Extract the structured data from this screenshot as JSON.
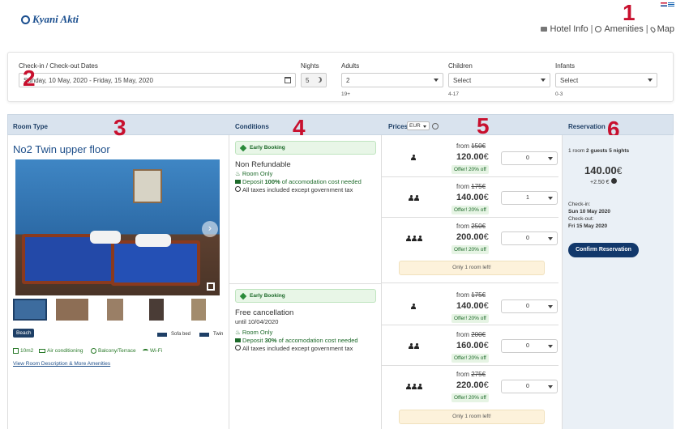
{
  "header": {
    "brand": "Kyani Akti",
    "nav": {
      "hotel_info": "Hotel Info",
      "amenities": "Amenities",
      "map": "Map",
      "sep": "|"
    }
  },
  "annotations": [
    "1",
    "2",
    "3",
    "4",
    "5",
    "6"
  ],
  "search": {
    "dates_label": "Check-in / Check-out Dates",
    "dates_value": "Sunday, 10 May, 2020 - Friday, 15 May, 2020",
    "nights_label": "Nights",
    "nights_value": "5",
    "adults_label": "Adults",
    "adults_value": "2",
    "adults_sub": "19+",
    "children_label": "Children",
    "children_value": "Select",
    "children_sub": "4-17",
    "infants_label": "Infants",
    "infants_value": "Select",
    "infants_sub": "0-3"
  },
  "table_headers": {
    "room_type": "Room Type",
    "conditions": "Conditions",
    "prices": "Prices",
    "currency": "EUR",
    "reservation": "Reservation"
  },
  "room": {
    "title": "No2 Twin upper floor",
    "tag": "Beach",
    "beds": [
      "Sofa bed",
      "Twin"
    ],
    "amenities": [
      "10m2",
      "Air conditioning",
      "Balcony/Terrace",
      "Wi-Fi"
    ],
    "link": "View Room Description & More Amenities"
  },
  "offers": [
    {
      "badge": "Early Booking",
      "name": "Non Refundable",
      "until": "",
      "meal": "Room Only",
      "deposit_pre": "Deposit ",
      "deposit_bold": "100%",
      "deposit_post": " of accomodation cost needed",
      "taxes": "All taxes included except government tax",
      "rows": [
        {
          "old_pre": "from ",
          "old": "150€",
          "price": "120.00",
          "cur": "€",
          "offer": "Offer! 20% off",
          "qty": "0",
          "persons": 1
        },
        {
          "old_pre": "from ",
          "old": "175€",
          "price": "140.00",
          "cur": "€",
          "offer": "Offer! 20% off",
          "qty": "1",
          "persons": 2
        },
        {
          "old_pre": "from ",
          "old": "250€",
          "price": "200.00",
          "cur": "€",
          "offer": "Offer! 20% off",
          "qty": "0",
          "persons": 3
        }
      ],
      "note": "Only 1 room left!"
    },
    {
      "badge": "Early Booking",
      "name": "Free cancellation",
      "until": "until 10/04/2020",
      "meal": "Room Only",
      "deposit_pre": "Deposit ",
      "deposit_bold": "30%",
      "deposit_post": " of accomodation cost needed",
      "taxes": "All taxes included except government tax",
      "rows": [
        {
          "old_pre": "from ",
          "old": "175€",
          "price": "140.00",
          "cur": "€",
          "offer": "Offer! 20% off",
          "qty": "0",
          "persons": 1
        },
        {
          "old_pre": "from ",
          "old": "200€",
          "price": "160.00",
          "cur": "€",
          "offer": "Offer! 20% off",
          "qty": "0",
          "persons": 2
        },
        {
          "old_pre": "from ",
          "old": "275€",
          "price": "220.00",
          "cur": "€",
          "offer": "Offer! 20% off",
          "qty": "0",
          "persons": 3
        }
      ],
      "note": "Only 1 room left!"
    }
  ],
  "reservation": {
    "summary_rooms": "1 room",
    "summary_guests": "2 guests",
    "summary_nights": "5 nights",
    "total": "140.00",
    "cur": "€",
    "tax": "+2.50 €",
    "checkin_label": "Check-in:",
    "checkin_value": "Sun 10 May 2020",
    "checkout_label": "Check-out:",
    "checkout_value": "Fri 15 May 2020",
    "confirm": "Confirm Reservation"
  },
  "colors": {
    "accent": "#12386b",
    "header_bar": "#d9e3ee",
    "annotation": "#c8102e",
    "offer_green": "#1d6a2a"
  }
}
